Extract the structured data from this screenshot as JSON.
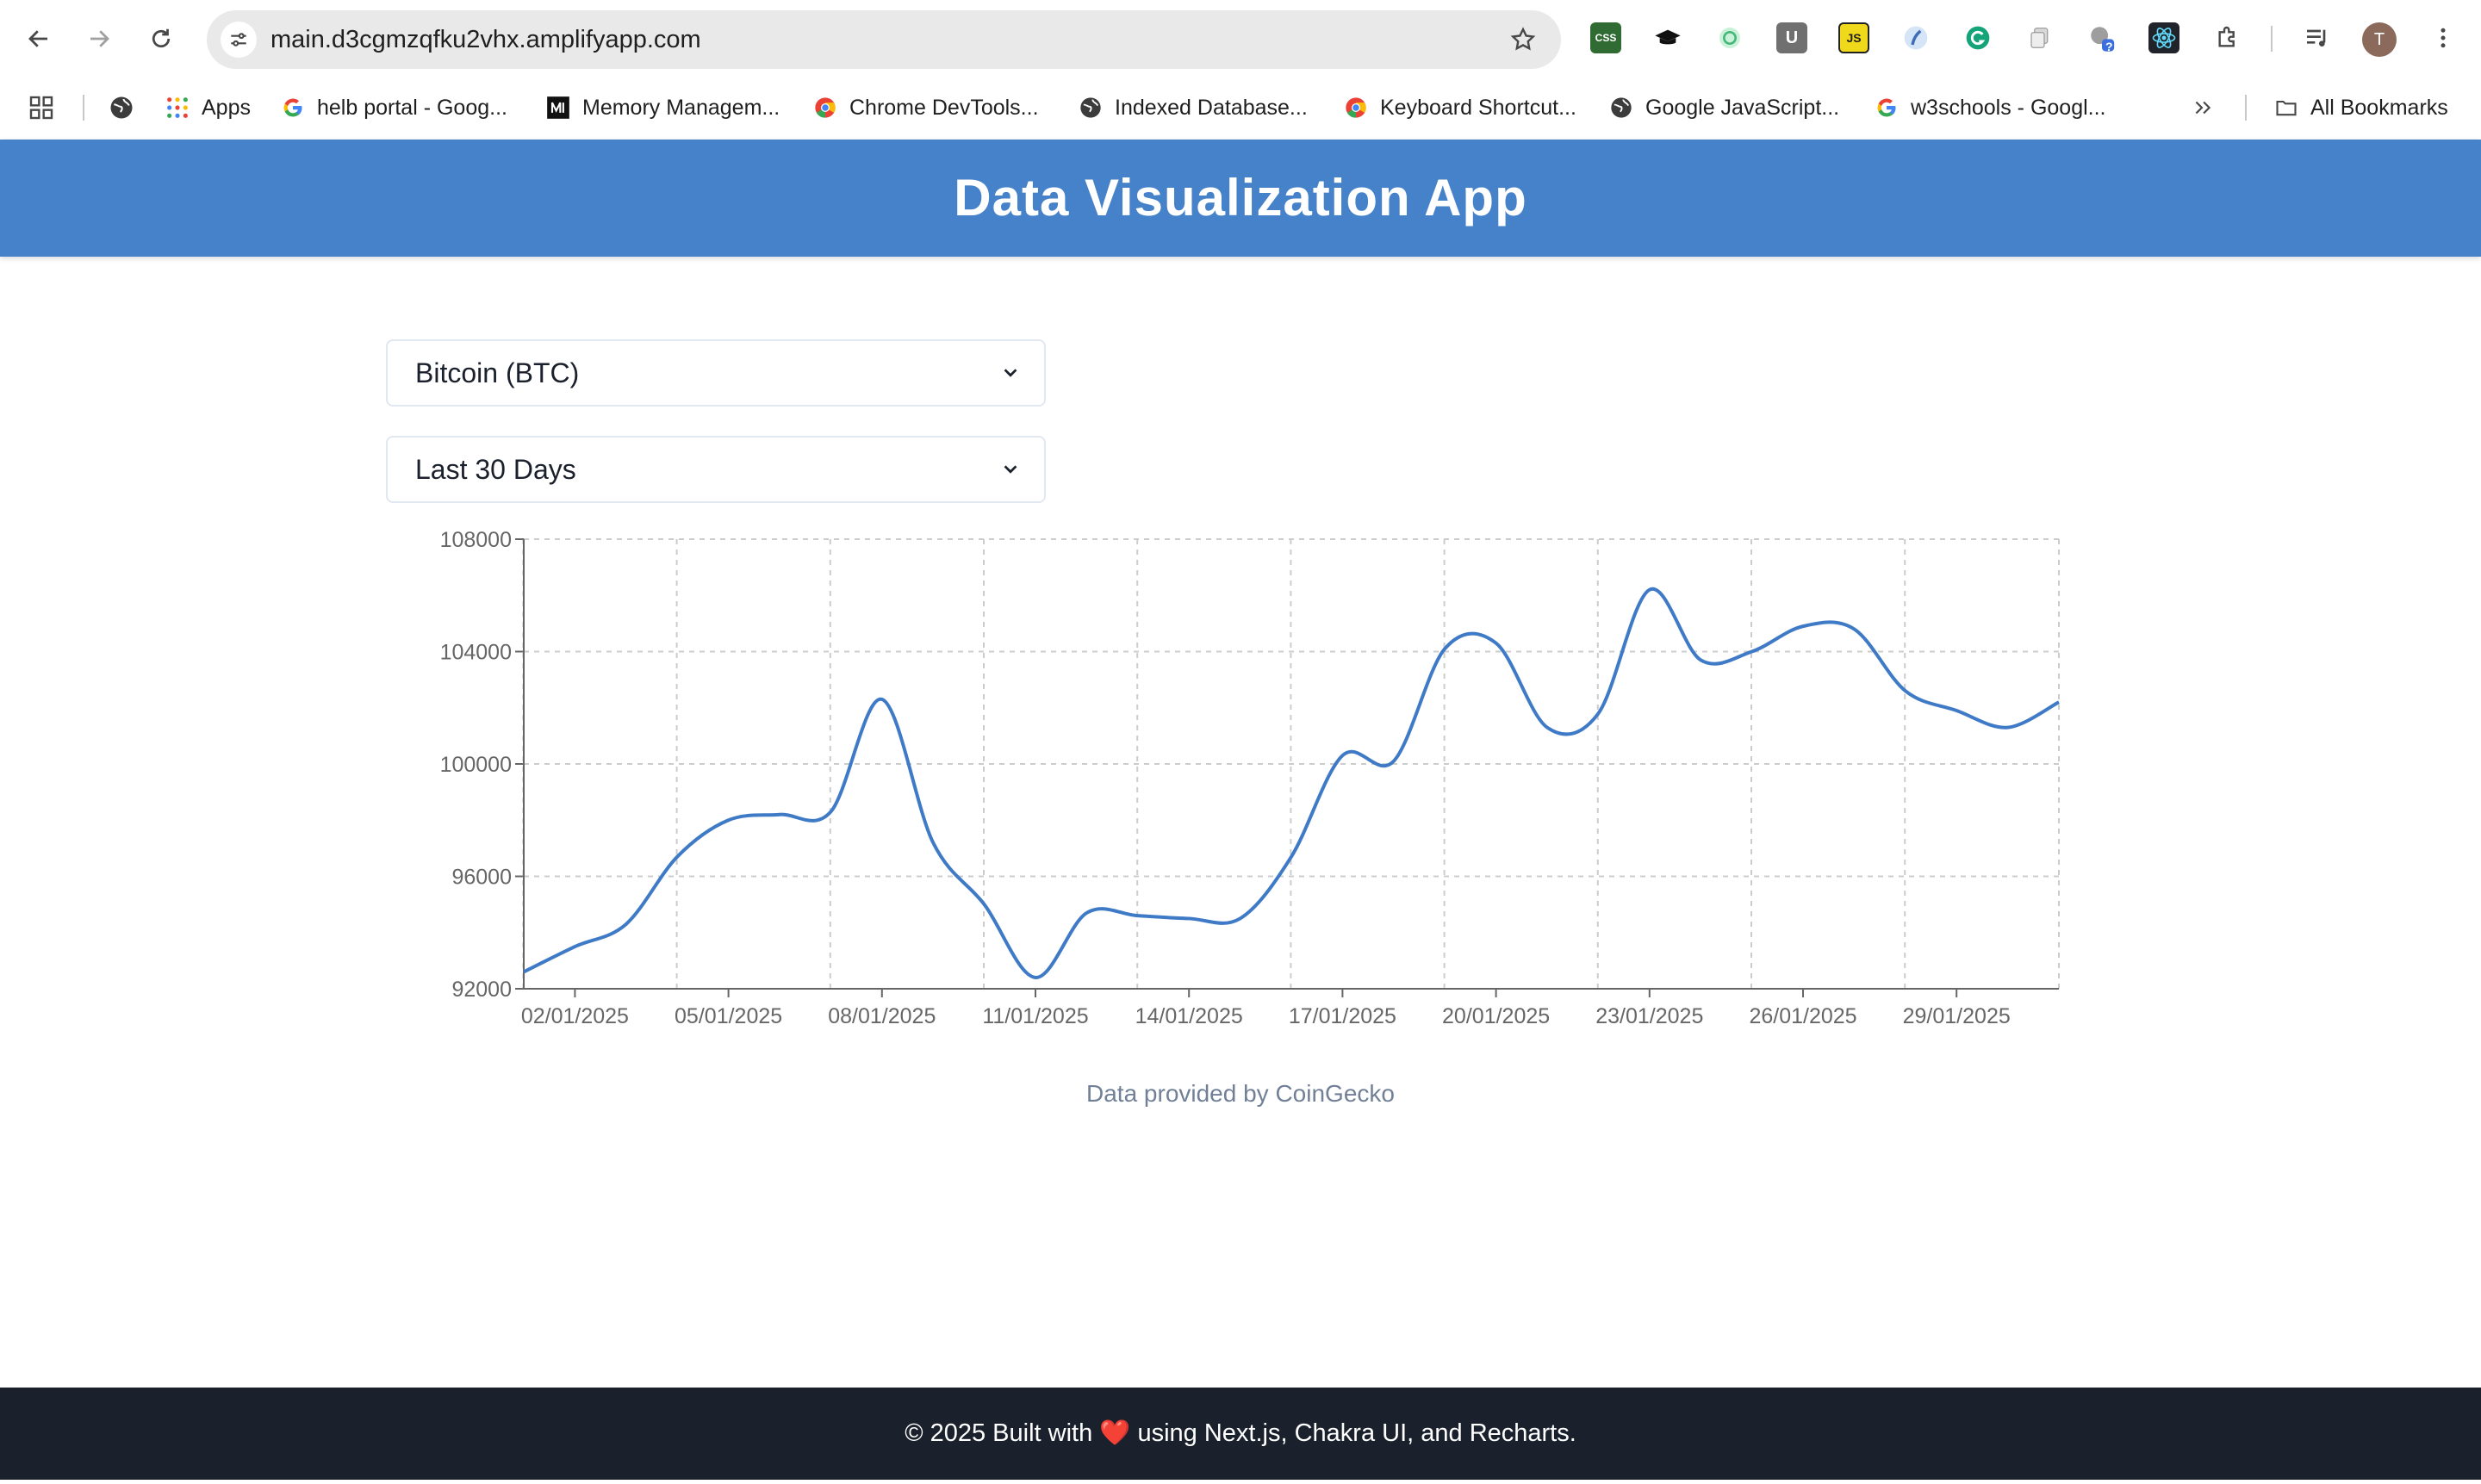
{
  "browser": {
    "url": "main.d3cgmzqfku2vhx.amplifyapp.com",
    "profile_initial": "T",
    "extensions": [
      "css-extension-icon",
      "graduation-cap-icon",
      "timer-extension-icon",
      "u-extension-icon",
      "js-extension-icon",
      "wave-extension-icon",
      "grammarly-icon",
      "copy-extension-icon",
      "help-extension-icon",
      "react-devtools-icon",
      "puzzle-piece-icon",
      "media-control-icon"
    ],
    "ext_labels": {
      "css": "CSS",
      "u": "U",
      "js": "JS",
      "help_badge": "?"
    },
    "bookmarks": [
      {
        "label": "Apps"
      },
      {
        "label": "helb portal - Goog..."
      },
      {
        "label": "Memory Managem..."
      },
      {
        "label": "Chrome DevTools..."
      },
      {
        "label": "Indexed Database..."
      },
      {
        "label": "Keyboard Shortcut..."
      },
      {
        "label": "Google JavaScript..."
      },
      {
        "label": "w3schools - Googl..."
      }
    ],
    "all_bookmarks_label": "All Bookmarks"
  },
  "app": {
    "title": "Data Visualization App",
    "coin_select": {
      "value": "Bitcoin (BTC)"
    },
    "range_select": {
      "value": "Last 30 Days"
    },
    "attribution": "Data provided by CoinGecko",
    "footer": {
      "prefix": "© 2025 Built with",
      "heart": "❤️",
      "suffix": "using Next.js, Chakra UI, and Recharts."
    },
    "colors": {
      "header": "#4682c9",
      "line": "#3f7ac7",
      "footer": "#1a202c"
    }
  },
  "chart_data": {
    "type": "line",
    "title": "",
    "xlabel": "",
    "ylabel": "",
    "ylim": [
      92000,
      108000
    ],
    "yticks": [
      "92000",
      "96000",
      "100000",
      "104000",
      "108000"
    ],
    "xtick_labels": [
      "02/01/2025",
      "05/01/2025",
      "08/01/2025",
      "11/01/2025",
      "14/01/2025",
      "17/01/2025",
      "20/01/2025",
      "23/01/2025",
      "26/01/2025",
      "29/01/2025"
    ],
    "grid": true,
    "x": [
      "01/01/2025",
      "02/01/2025",
      "03/01/2025",
      "04/01/2025",
      "05/01/2025",
      "06/01/2025",
      "07/01/2025",
      "08/01/2025",
      "09/01/2025",
      "10/01/2025",
      "11/01/2025",
      "12/01/2025",
      "13/01/2025",
      "14/01/2025",
      "15/01/2025",
      "16/01/2025",
      "17/01/2025",
      "18/01/2025",
      "19/01/2025",
      "20/01/2025",
      "21/01/2025",
      "22/01/2025",
      "23/01/2025",
      "24/01/2025",
      "25/01/2025",
      "26/01/2025",
      "27/01/2025",
      "28/01/2025",
      "29/01/2025",
      "30/01/2025",
      "31/01/2025"
    ],
    "series": [
      {
        "values": [
          92600,
          93500,
          94300,
          96700,
          98000,
          98200,
          98300,
          102300,
          97200,
          95000,
          92400,
          94700,
          94600,
          94500,
          94500,
          96700,
          100300,
          100100,
          104100,
          104300,
          101300,
          101800,
          106200,
          103700,
          104000,
          104900,
          104800,
          102600,
          101900,
          101300,
          102200
        ]
      }
    ]
  }
}
